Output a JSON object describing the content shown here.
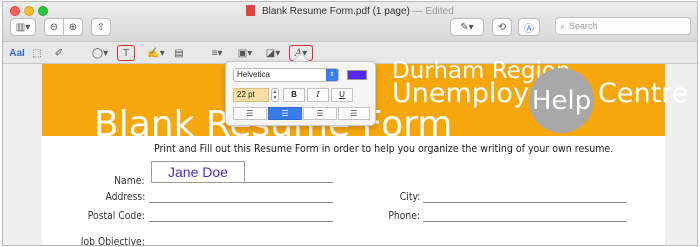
{
  "window": {
    "title": "Blank Resume Form.pdf (1 page)",
    "edited": "— Edited"
  },
  "toolbar": {
    "search_placeholder": "Search",
    "icons": [
      "sidebar-icon",
      "zoom-out-icon",
      "zoom-in-icon",
      "share-icon",
      "markup-pen-icon",
      "rotate-icon",
      "annotate-icon",
      "search-icon"
    ]
  },
  "markup_toolbar": {
    "text_selection_label": "AaI",
    "highlighted_tools": [
      "text-box-tool",
      "text-style-tool"
    ]
  },
  "document": {
    "header_line1": "Durham Region",
    "header_line2": "Unemployed",
    "header_help": "Help",
    "header_centre": "Centre",
    "title": "Blank Resume Form",
    "instructions": "Print and Fill out this Resume Form in order to help you organize the writing of your own resume.",
    "fields": {
      "name_label": "Name:",
      "name_value": "Jane Doe",
      "address_label": "Address:",
      "city_label": "City:",
      "postal_label": "Postal Code:",
      "phone_label": "Phone:",
      "objective_label": "Job Objective:"
    }
  },
  "text_popover": {
    "font": "Helvetica",
    "size": "22 pt",
    "bold": "B",
    "italic": "I",
    "underline": "U",
    "color": "#5527e8",
    "alignments": [
      "align-left",
      "align-center",
      "align-right",
      "align-justify"
    ],
    "selected_alignment": "align-center"
  },
  "colors": {
    "banner": "#f5a70c",
    "highlight_red": "#e22b3d",
    "accent_blue": "#3a7bed"
  }
}
